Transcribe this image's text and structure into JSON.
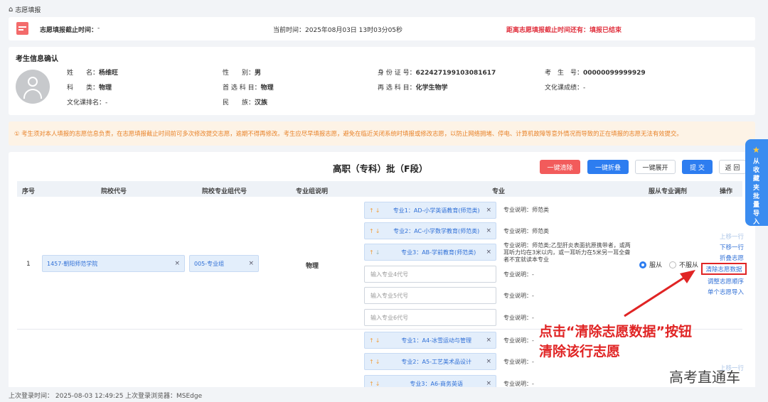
{
  "breadcrumb": {
    "label": "志愿填报"
  },
  "topbar": {
    "deadline_label": "志愿填报截止时间：",
    "deadline_value": "-",
    "current_time": "当前时间：2025年08月03日 13时03分05秒",
    "remaining": "距离志愿填报截止时间还有：填报已结束"
  },
  "student": {
    "section_title": "考生信息确认",
    "fields": [
      {
        "label": "姓　　名：",
        "value": "杨维旺"
      },
      {
        "label": "性　　别：",
        "value": "男"
      },
      {
        "label": "身 份 证 号：",
        "value": "622427199103081617"
      },
      {
        "label": "考　生　号：",
        "value": "00000099999929"
      },
      {
        "label": "科　　类：",
        "value": "物理"
      },
      {
        "label": "首 选 科 目：",
        "value": "物理"
      },
      {
        "label": "再 选 科 目：",
        "value": "化学生物学"
      },
      {
        "label": "文化课成绩：",
        "value": "-"
      },
      {
        "label": "文化课排名：",
        "value": "-"
      },
      {
        "label": "民　　族：",
        "value": "汉族"
      }
    ]
  },
  "notice": "① 考生须对本人填报的志愿信息负责，在志愿填报截止时间前可多次修改提交志愿，逾期不得再修改。考生应尽早填报志愿，避免在临近关闭系统时填报或修改志愿，以防止网络拥堵、停电、计算机故障等意外情况而导致的正在填报的志愿无法有效提交。",
  "batch_title": "高职（专科）批（F段）",
  "toolbar": {
    "clear_all": "一键清除",
    "collapse_all": "一键折叠",
    "expand_all": "一键展开",
    "submit": "提 交",
    "back": "返 回"
  },
  "side_tab": "从收藏夹批量导入",
  "table": {
    "headers": [
      "序号",
      "院校代号",
      "院校专业组代号",
      "专业组说明",
      "专业",
      "服从专业调剂",
      "操作"
    ]
  },
  "row1": {
    "index": "1",
    "school": "1457-朝阳师范学院",
    "group": "005-专业组",
    "group_desc": "物理",
    "majors": [
      {
        "name": "专业1：AD-小学英语教育(师范类)",
        "desc": "专业说明：师范类"
      },
      {
        "name": "专业2：AC-小学数学教育(师范类)",
        "desc": "专业说明：师范类"
      },
      {
        "name": "专业3：AB-学前教育(师范类)",
        "desc": "专业说明：师范类;乙型肝炎表面抗原携带者，或两耳听力均在3米以内，或一耳听力在5米另一耳全聋者不宜就读本专业"
      }
    ],
    "inputs": [
      {
        "placeholder": "输入专业4代号",
        "desc": "专业说明：-"
      },
      {
        "placeholder": "输入专业5代号",
        "desc": "专业说明：-"
      },
      {
        "placeholder": "输入专业6代号",
        "desc": "专业说明：-"
      }
    ],
    "obey": "服从",
    "not_obey": "不服从",
    "ops": [
      "上移一行",
      "下移一行",
      "折叠志愿",
      "清除志愿数据",
      "调整志愿顺序",
      "单个志愿导入"
    ]
  },
  "row2": {
    "majors": [
      {
        "name": "专业1：A4-冰雪运动与管理",
        "desc": "专业说明：-"
      },
      {
        "name": "专业2：A5-工艺美术品设计",
        "desc": "专业说明：-"
      },
      {
        "name": "专业3：A6-商务英语",
        "desc": "专业说明：-"
      }
    ],
    "op": "上移一行"
  },
  "annotation": {
    "line1": "点击“清除志愿数据”按钮",
    "line2": "清除该行志愿"
  },
  "watermark": "高考直通车",
  "footer": {
    "last_login_time": "上次登录时间： 2025-08-03 12:49:25",
    "last_login_browser": "上次登录浏览器：MSEdge"
  },
  "colors": {
    "accent": "#2d7df0",
    "danger": "#e0303d",
    "warning": "#e8832a"
  }
}
